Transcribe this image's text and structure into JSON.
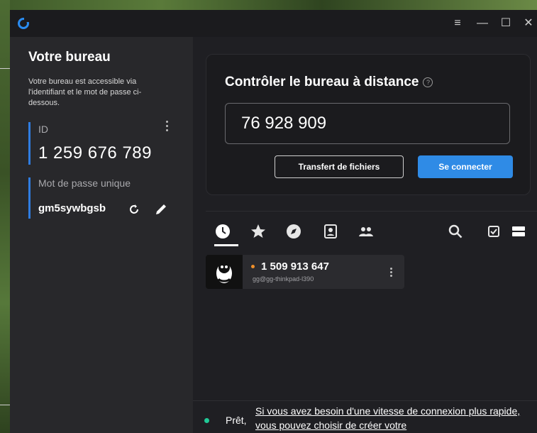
{
  "titlebar": {
    "menu_glyph": "≡",
    "minimize_glyph": "—",
    "maximize_glyph": "☐",
    "close_glyph": "✕"
  },
  "left_panel": {
    "title": "Votre bureau",
    "description": "Votre bureau est accessible via l'identifiant et le mot de passe ci-dessous.",
    "id_label": "ID",
    "id_value": "1 259 676 789",
    "password_label": "Mot de passe unique",
    "password_value": "gm5sywbgsb"
  },
  "remote": {
    "title": "Contrôler le bureau à distance",
    "input_value": "76 928 909",
    "transfer_button": "Transfert de fichiers",
    "connect_button": "Se connecter"
  },
  "peer": {
    "id": "1 509 913 647",
    "user": "gg@gg-thinkpad-l390"
  },
  "status": {
    "text": "Prêt,",
    "link": "Si vous avez besoin d'une vitesse de connexion plus rapide, vous pouvez choisir de créer votre"
  },
  "colors": {
    "accent": "#2f8be6",
    "status_ok": "#20c997",
    "peer_online": "#f0902a"
  },
  "icons": {
    "tabs": [
      "recent-icon",
      "star-icon",
      "compass-icon",
      "address-book-icon",
      "group-icon"
    ],
    "right_tools": [
      "search-icon",
      "select-checkbox-icon",
      "list-view-icon"
    ]
  }
}
